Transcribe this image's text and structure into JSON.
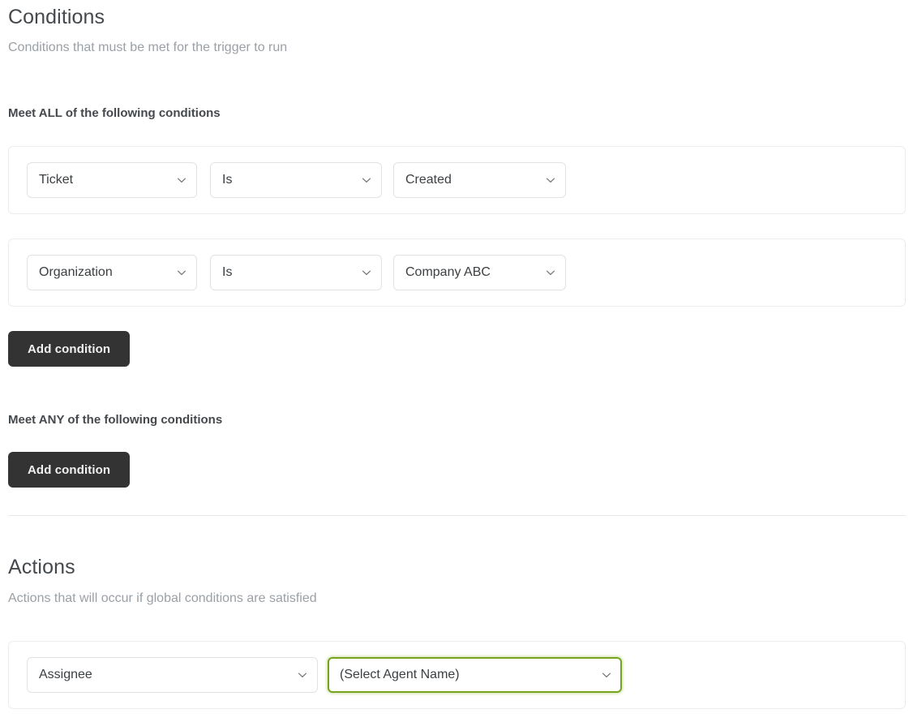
{
  "conditions": {
    "title": "Conditions",
    "subtitle": "Conditions that must be met for the trigger to run",
    "all_group": {
      "label": "Meet ALL of the following conditions",
      "add_button": "Add condition",
      "rows": [
        {
          "field": "Ticket",
          "operator": "Is",
          "value": "Created"
        },
        {
          "field": "Organization",
          "operator": "Is",
          "value": "Company ABC"
        }
      ]
    },
    "any_group": {
      "label": "Meet ANY of the following conditions",
      "add_button": "Add condition",
      "rows": []
    }
  },
  "actions": {
    "title": "Actions",
    "subtitle": "Actions that will occur if global conditions are satisfied",
    "rows": [
      {
        "field": "Assignee",
        "value": "(Select Agent Name)"
      }
    ]
  },
  "icons": {
    "chevron": "chevron-down-icon"
  },
  "colors": {
    "focus_green": "#76a420",
    "button_dark": "#333333",
    "heading": "#45494d",
    "muted_text": "#9aa0a6",
    "card_border": "#ececec",
    "control_border": "#e2e2e2"
  }
}
